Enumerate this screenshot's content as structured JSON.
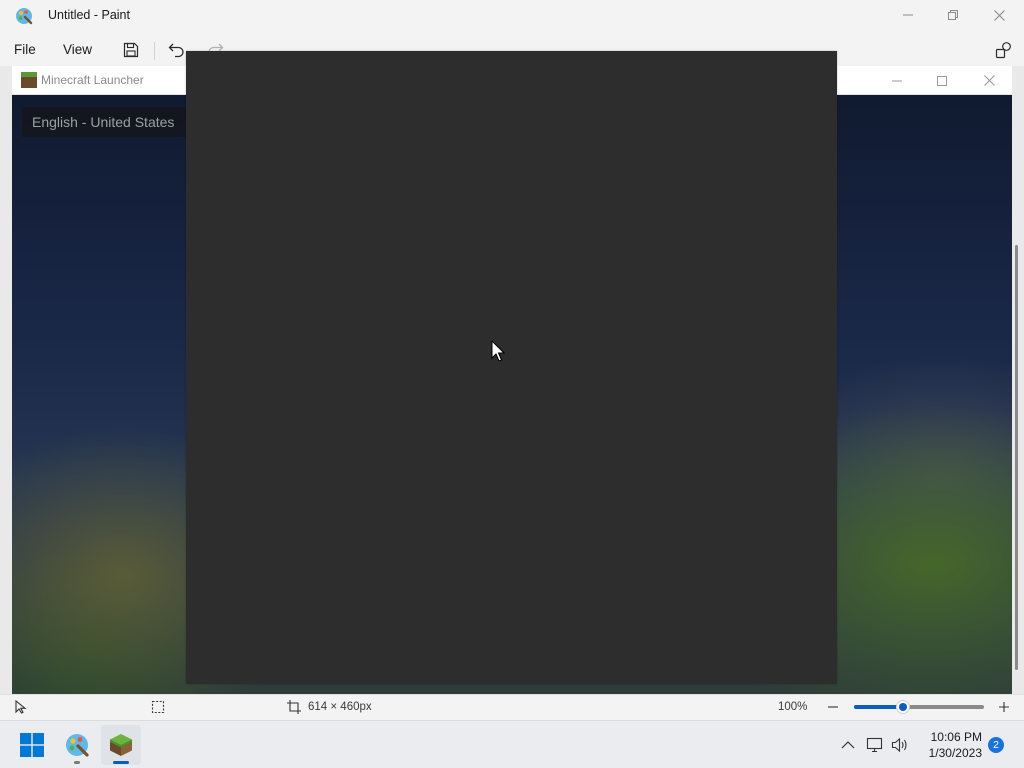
{
  "paint": {
    "title": "Untitled - Paint",
    "menu": {
      "file": "File",
      "view": "View"
    }
  },
  "launcher": {
    "title": "Minecraft Launcher",
    "language": "English - United States"
  },
  "statusbar": {
    "canvas_size": "614 × 460px",
    "zoom": "100%",
    "zoom_level": 0.38
  },
  "taskbar": {
    "time": "10:06 PM",
    "date": "1/30/2023",
    "notification_count": "2"
  },
  "colors": {
    "canvas": "#2d2d2d",
    "accent": "#0a5cc0",
    "start_blue": "#0078d4"
  },
  "icons": [
    "paint-app-icon",
    "minimize-icon",
    "maximize-icon",
    "close-icon",
    "save-icon",
    "undo-icon",
    "redo-icon",
    "settings-icon",
    "minecraft-icon",
    "pointer-icon",
    "selection-icon",
    "canvas-size-icon",
    "zoom-out-icon",
    "zoom-in-icon",
    "windows-start-icon",
    "chevron-up-icon",
    "display-icon",
    "volume-icon"
  ]
}
